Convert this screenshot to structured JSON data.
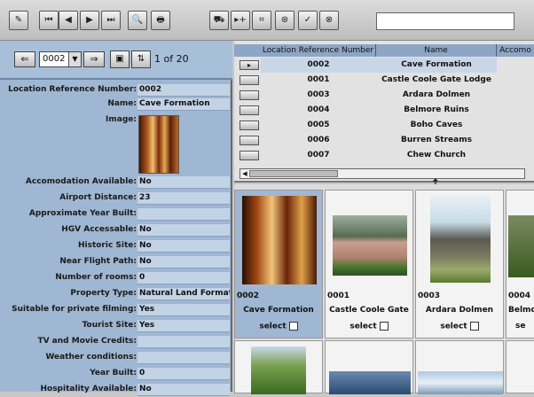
{
  "toolbar": {
    "buttons": [
      {
        "icon": "edit-record-icon",
        "glyph": "✎"
      },
      {
        "icon": "first-record-icon",
        "glyph": "⏮"
      },
      {
        "icon": "previous-record-icon",
        "glyph": "◀"
      },
      {
        "icon": "next-record-icon",
        "glyph": "▶"
      },
      {
        "icon": "last-record-icon",
        "glyph": "⏭"
      },
      {
        "icon": "search-icon",
        "glyph": "🔍"
      },
      {
        "icon": "print-icon",
        "glyph": "🖶"
      },
      {
        "icon": "cart-icon",
        "glyph": "⛟"
      },
      {
        "icon": "add-record-icon",
        "glyph": "▸+"
      },
      {
        "icon": "grid-icon",
        "glyph": "⌗"
      },
      {
        "icon": "filter-icon",
        "glyph": "⊛"
      },
      {
        "icon": "check-icon",
        "glyph": "✓"
      },
      {
        "icon": "cancel-icon",
        "glyph": "⊗"
      }
    ],
    "search_value": ""
  },
  "navigator": {
    "back_glyph": "⇐",
    "forward_glyph": "⇒",
    "record_value": "0002",
    "count_text": "1 of 20"
  },
  "record": {
    "location_reference_label": "Location Reference Number:",
    "location_reference_value": "0002",
    "name_label": "Name:",
    "name_value": "Cave Formation",
    "image_label": "Image:",
    "fields": [
      {
        "label": "Accomodation Available:",
        "value": "No"
      },
      {
        "label": "Airport Distance:",
        "value": "23"
      },
      {
        "label": "Approximate Year Built:",
        "value": ""
      },
      {
        "label": "HGV Accessable:",
        "value": "No"
      },
      {
        "label": "Historic Site:",
        "value": "No"
      },
      {
        "label": "Near Flight Path:",
        "value": "No"
      },
      {
        "label": "Number of rooms:",
        "value": "0"
      },
      {
        "label": "Property Type:",
        "value": "Natural Land Format"
      },
      {
        "label": "Suitable for private filming:",
        "value": "Yes"
      },
      {
        "label": "Tourist Site:",
        "value": "Yes"
      },
      {
        "label": "TV and Movie Credits:",
        "value": ""
      },
      {
        "label": "Weather conditions:",
        "value": ""
      },
      {
        "label": "Year Built:",
        "value": "0"
      },
      {
        "label": "Hospitality Available:",
        "value": "No"
      }
    ]
  },
  "table": {
    "columns": [
      "Location Reference Number",
      "Name",
      "Accomo"
    ],
    "rows": [
      {
        "ref": "0002",
        "name": "Cave Formation",
        "selected": true
      },
      {
        "ref": "0001",
        "name": "Castle Coole Gate Lodge",
        "selected": false
      },
      {
        "ref": "0003",
        "name": "Ardara Dolmen",
        "selected": false
      },
      {
        "ref": "0004",
        "name": "Belmore Ruins",
        "selected": false
      },
      {
        "ref": "0005",
        "name": "Boho Caves",
        "selected": false
      },
      {
        "ref": "0006",
        "name": "Burren Streams",
        "selected": false
      },
      {
        "ref": "0007",
        "name": "Chew Church",
        "selected": false
      }
    ]
  },
  "thumbnails": [
    {
      "num": "0002",
      "caption": "Cave Formation",
      "select_label": "select"
    },
    {
      "num": "0001",
      "caption": "Castle Coole Gate",
      "select_label": "select"
    },
    {
      "num": "0003",
      "caption": "Ardara Dolmen",
      "select_label": "select"
    },
    {
      "num": "0004",
      "caption": "Belmo",
      "select_label": "se"
    }
  ]
}
